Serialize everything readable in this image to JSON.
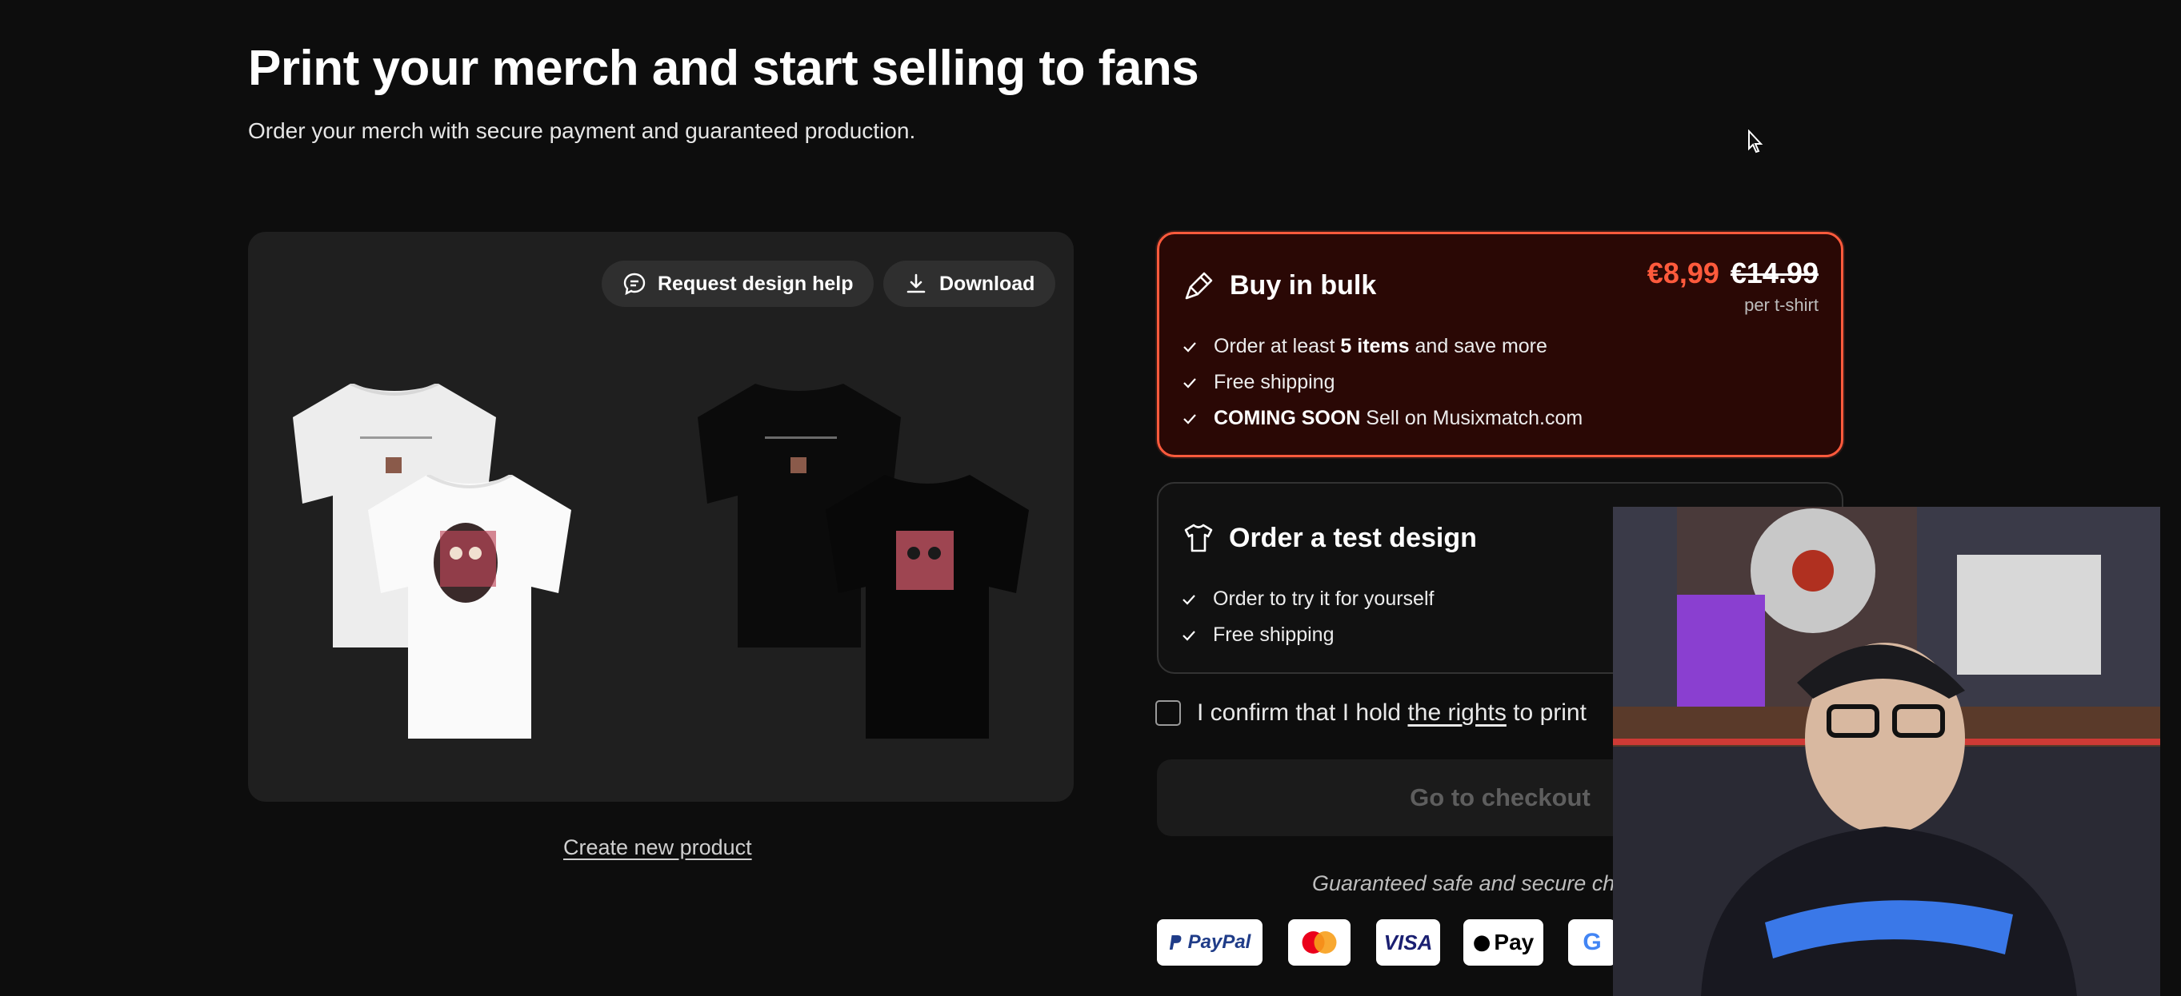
{
  "header": {
    "title": "Print your merch and start selling to fans",
    "subtitle": "Order your merch with secure payment and guaranteed production."
  },
  "preview": {
    "request_help_label": "Request design help",
    "download_label": "Download",
    "create_new_label": "Create new product"
  },
  "bulk": {
    "title": "Buy in bulk",
    "price_new": "€8,99",
    "price_old": "€14.99",
    "price_unit": "per t-shirt",
    "f1_pre": "Order at least",
    "f1_bold": "5 items",
    "f1_post": "and save more",
    "f2": "Free shipping",
    "f3_bold": "COMING SOON",
    "f3_post": "Sell on Musixmatch.com"
  },
  "test_design": {
    "title": "Order a test design",
    "f1": "Order to try it for yourself",
    "f2": "Free shipping"
  },
  "confirm": {
    "pre": "I confirm that I hold",
    "link": "the rights",
    "post": "to print"
  },
  "checkout_label": "Go to checkout",
  "secure_text": "Guaranteed safe and secure ch",
  "payments": {
    "paypal": "PayPal",
    "visa": "VISA",
    "apple_pay": "Pay",
    "google": "G"
  },
  "colors": {
    "accent": "#ff5a3c",
    "bulk_bg": "#2a0805",
    "bg": "#0d0d0d",
    "panel": "#1f1f1f"
  }
}
